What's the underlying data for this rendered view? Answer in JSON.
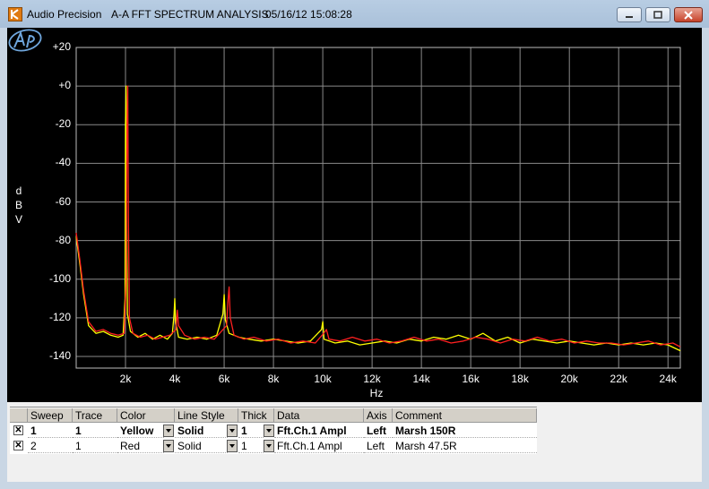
{
  "window": {
    "app_name": "Audio Precision",
    "chart_title": "A-A FFT SPECTRUM ANALYSIS",
    "timestamp": "05/16/12 15:08:28"
  },
  "chart_data": {
    "type": "line",
    "title": "",
    "xlabel": "Hz",
    "ylabel_letters": [
      "d",
      "B",
      "V"
    ],
    "ylim": [
      -146,
      20
    ],
    "xlim": [
      0,
      24500
    ],
    "grid": true,
    "y_ticks": [
      "+20",
      "+0",
      "-20",
      "-40",
      "-60",
      "-80",
      "-100",
      "-120",
      "-140"
    ],
    "x_ticks": [
      "2k",
      "4k",
      "6k",
      "8k",
      "10k",
      "12k",
      "14k",
      "16k",
      "18k",
      "20k",
      "22k",
      "24k"
    ],
    "series": [
      {
        "color": "#ffff00",
        "points": [
          [
            0,
            -78
          ],
          [
            150,
            -92
          ],
          [
            300,
            -108
          ],
          [
            500,
            -124
          ],
          [
            800,
            -128
          ],
          [
            1100,
            -127
          ],
          [
            1400,
            -129
          ],
          [
            1700,
            -130
          ],
          [
            1900,
            -129
          ],
          [
            1980,
            -110
          ],
          [
            2000,
            -20
          ],
          [
            2020,
            0
          ],
          [
            2040,
            -60
          ],
          [
            2080,
            -118
          ],
          [
            2200,
            -127
          ],
          [
            2500,
            -130
          ],
          [
            2800,
            -128
          ],
          [
            3100,
            -131
          ],
          [
            3400,
            -129
          ],
          [
            3700,
            -131
          ],
          [
            3900,
            -128
          ],
          [
            3970,
            -118
          ],
          [
            4000,
            -110
          ],
          [
            4030,
            -122
          ],
          [
            4150,
            -130
          ],
          [
            4500,
            -131
          ],
          [
            4900,
            -130
          ],
          [
            5300,
            -131
          ],
          [
            5700,
            -129
          ],
          [
            5950,
            -118
          ],
          [
            6000,
            -108
          ],
          [
            6050,
            -121
          ],
          [
            6200,
            -128
          ],
          [
            6600,
            -130
          ],
          [
            7000,
            -131
          ],
          [
            7500,
            -132
          ],
          [
            8000,
            -131
          ],
          [
            8500,
            -132
          ],
          [
            9000,
            -133
          ],
          [
            9500,
            -132
          ],
          [
            9950,
            -126
          ],
          [
            10000,
            -122
          ],
          [
            10050,
            -131
          ],
          [
            10500,
            -133
          ],
          [
            11000,
            -132
          ],
          [
            11500,
            -134
          ],
          [
            12000,
            -133
          ],
          [
            12500,
            -132
          ],
          [
            13000,
            -133
          ],
          [
            13500,
            -131
          ],
          [
            14000,
            -132
          ],
          [
            14500,
            -130
          ],
          [
            15000,
            -131
          ],
          [
            15500,
            -129
          ],
          [
            16000,
            -131
          ],
          [
            16500,
            -128
          ],
          [
            17000,
            -132
          ],
          [
            17500,
            -130
          ],
          [
            18000,
            -133
          ],
          [
            18500,
            -131
          ],
          [
            19000,
            -132
          ],
          [
            19500,
            -133
          ],
          [
            20000,
            -132
          ],
          [
            20500,
            -133
          ],
          [
            21000,
            -134
          ],
          [
            21500,
            -133
          ],
          [
            22000,
            -134
          ],
          [
            22500,
            -133
          ],
          [
            23000,
            -134
          ],
          [
            23500,
            -133
          ],
          [
            24000,
            -134
          ],
          [
            24500,
            -137
          ]
        ]
      },
      {
        "color": "#ff2020",
        "points": [
          [
            0,
            -76
          ],
          [
            150,
            -90
          ],
          [
            300,
            -106
          ],
          [
            500,
            -122
          ],
          [
            800,
            -127
          ],
          [
            1100,
            -126
          ],
          [
            1400,
            -128
          ],
          [
            1700,
            -129
          ],
          [
            1950,
            -128
          ],
          [
            2030,
            -100
          ],
          [
            2060,
            -20
          ],
          [
            2090,
            0
          ],
          [
            2120,
            -70
          ],
          [
            2160,
            -120
          ],
          [
            2300,
            -128
          ],
          [
            2600,
            -130
          ],
          [
            2900,
            -129
          ],
          [
            3200,
            -131
          ],
          [
            3500,
            -130
          ],
          [
            3800,
            -129
          ],
          [
            4050,
            -126
          ],
          [
            4100,
            -116
          ],
          [
            4150,
            -124
          ],
          [
            4400,
            -129
          ],
          [
            4800,
            -131
          ],
          [
            5200,
            -130
          ],
          [
            5600,
            -131
          ],
          [
            6100,
            -124
          ],
          [
            6150,
            -112
          ],
          [
            6200,
            -104
          ],
          [
            6250,
            -120
          ],
          [
            6400,
            -129
          ],
          [
            6800,
            -131
          ],
          [
            7200,
            -130
          ],
          [
            7700,
            -132
          ],
          [
            8200,
            -131
          ],
          [
            8700,
            -133
          ],
          [
            9200,
            -132
          ],
          [
            9700,
            -133
          ],
          [
            10100,
            -127
          ],
          [
            10150,
            -126
          ],
          [
            10250,
            -131
          ],
          [
            10700,
            -132
          ],
          [
            11200,
            -130
          ],
          [
            11700,
            -132
          ],
          [
            12200,
            -131
          ],
          [
            12700,
            -133
          ],
          [
            13200,
            -132
          ],
          [
            13700,
            -130
          ],
          [
            14200,
            -132
          ],
          [
            14700,
            -131
          ],
          [
            15200,
            -133
          ],
          [
            15700,
            -132
          ],
          [
            16200,
            -130
          ],
          [
            16700,
            -131
          ],
          [
            17200,
            -133
          ],
          [
            17700,
            -131
          ],
          [
            18200,
            -132
          ],
          [
            18700,
            -130
          ],
          [
            19200,
            -132
          ],
          [
            19700,
            -131
          ],
          [
            20200,
            -133
          ],
          [
            20700,
            -132
          ],
          [
            21200,
            -133
          ],
          [
            21700,
            -133
          ],
          [
            22200,
            -134
          ],
          [
            22700,
            -133
          ],
          [
            23200,
            -132
          ],
          [
            23700,
            -134
          ],
          [
            24200,
            -133
          ],
          [
            24500,
            -135
          ]
        ]
      }
    ]
  },
  "legend": {
    "headers": [
      "Sweep",
      "Trace",
      "Color",
      "Line Style",
      "Thick",
      "Data",
      "Axis",
      "Comment"
    ],
    "rows": [
      {
        "checked": "✕",
        "sweep": "1",
        "trace": "1",
        "color": "Yellow",
        "line_style": "Solid",
        "thick": "1",
        "data": "Fft.Ch.1 Ampl",
        "axis": "Left",
        "comment": "Marsh 150R"
      },
      {
        "checked": "✕",
        "sweep": "2",
        "trace": "1",
        "color": "Red",
        "line_style": "Solid",
        "thick": "1",
        "data": "Fft.Ch.1 Ampl",
        "axis": "Left",
        "comment": "Marsh 47.5R"
      }
    ]
  }
}
